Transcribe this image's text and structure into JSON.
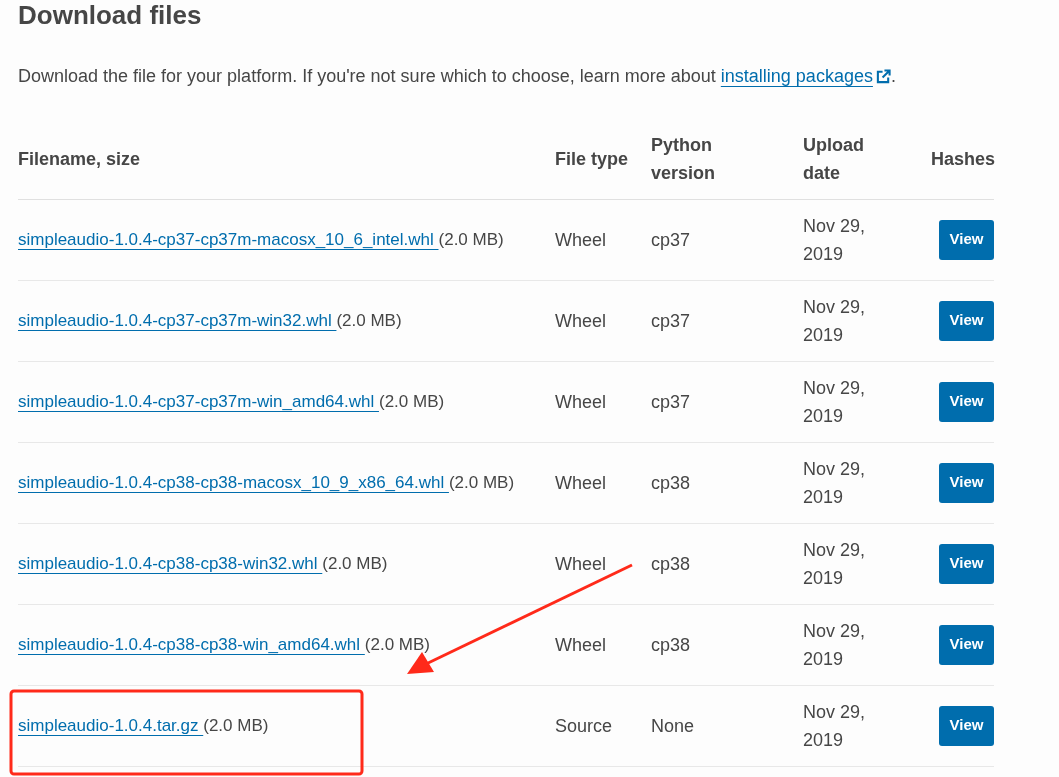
{
  "heading": "Download files",
  "intro": {
    "text": "Download the file for your platform. If you're not sure which to choose, learn more about ",
    "link": "installing packages",
    "end": "."
  },
  "table": {
    "columns": [
      "Filename, size",
      "File type",
      "Python version",
      "Upload date",
      "Hashes"
    ],
    "rows": [
      {
        "filename": {
          "link": "simpleaudio-1.0.4-cp37-cp37m-macosx_10_6_intel.whl",
          "size": "(2.0 MB)"
        },
        "type": "Wheel",
        "python": "cp37",
        "date": "Nov 29, 2019",
        "hashes": "View"
      },
      {
        "filename": {
          "link": "simpleaudio-1.0.4-cp37-cp37m-win32.whl",
          "size": "(2.0 MB)"
        },
        "type": "Wheel",
        "python": "cp37",
        "date": "Nov 29, 2019",
        "hashes": "View"
      },
      {
        "filename": {
          "link": "simpleaudio-1.0.4-cp37-cp37m-win_amd64.whl",
          "size": "(2.0 MB)"
        },
        "type": "Wheel",
        "python": "cp37",
        "date": "Nov 29, 2019",
        "hashes": "View"
      },
      {
        "filename": {
          "link": "simpleaudio-1.0.4-cp38-cp38-macosx_10_9_x86_64.whl",
          "size": "(2.0 MB)"
        },
        "type": "Wheel",
        "python": "cp38",
        "date": "Nov 29, 2019",
        "hashes": "View"
      },
      {
        "filename": {
          "link": "simpleaudio-1.0.4-cp38-cp38-win32.whl",
          "size": "(2.0 MB)"
        },
        "type": "Wheel",
        "python": "cp38",
        "date": "Nov 29, 2019",
        "hashes": "View"
      },
      {
        "filename": {
          "link": "simpleaudio-1.0.4-cp38-cp38-win_amd64.whl",
          "size": "(2.0 MB)"
        },
        "type": "Wheel",
        "python": "cp38",
        "date": "Nov 29, 2019",
        "hashes": "View"
      },
      {
        "filename": {
          "link": "simpleaudio-1.0.4.tar.gz",
          "size": "(2.0 MB)"
        },
        "type": "Source",
        "python": "None",
        "date": "Nov 29, 2019",
        "hashes": "View"
      }
    ]
  }
}
